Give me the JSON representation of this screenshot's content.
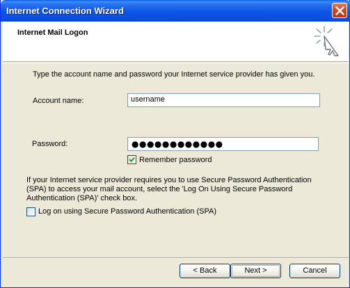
{
  "window": {
    "title": "Internet Connection Wizard",
    "close_icon": "close-icon"
  },
  "header": {
    "title": "Internet Mail Logon",
    "icon": "wizard-wand-icon"
  },
  "form": {
    "intro": "Type the account name and password your Internet service provider has given you.",
    "account_label": "Account name:",
    "account_value": "username",
    "password_label": "Password:",
    "password_mask": "●●●●●●●●●●●●",
    "remember_label": "Remember password",
    "remember_checked": true,
    "spa_note": "If your Internet service provider requires you to use Secure Password Authentication (SPA) to access your mail account, select the 'Log On Using Secure Password Authentication (SPA)' check box.",
    "spa_label": "Log on using Secure Password Authentication (SPA)",
    "spa_checked": false
  },
  "buttons": {
    "back": "< Back",
    "next": "Next >",
    "cancel": "Cancel"
  },
  "colors": {
    "titlebar": "#0a55e4",
    "dialog_bg": "#ece9d8",
    "close_button": "#d4461e"
  }
}
